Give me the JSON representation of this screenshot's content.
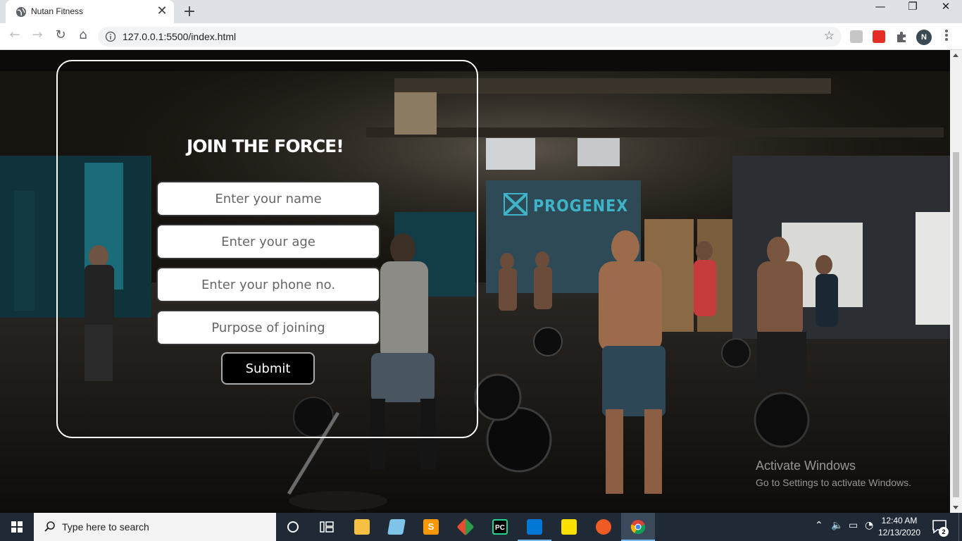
{
  "browser": {
    "tab_title": "Nutan Fitness",
    "tab_close": "✕",
    "new_tab": "+",
    "url": "127.0.0.1:5500/index.html",
    "profile_initial": "N",
    "window_controls": {
      "minimize": "—",
      "restore": "❐",
      "close": "✕"
    },
    "nav": {
      "back": "←",
      "forward": "→",
      "reload": "↻",
      "home": "⌂"
    },
    "bookmark_icon": "star-icon",
    "extensions": [
      "translate-extension-icon",
      "youtube-extension-icon",
      "puzzle-extensions-icon"
    ]
  },
  "page": {
    "form": {
      "title": "JOIN THE FORCE!",
      "name_placeholder": "Enter your name",
      "age_placeholder": "Enter your age",
      "phone_placeholder": "Enter your phone no.",
      "purpose_placeholder": "Purpose of joining",
      "submit_label": "Submit"
    },
    "background_sign": "PROGENEX",
    "activation": {
      "title": "Activate Windows",
      "subtitle": "Go to Settings to activate Windows."
    }
  },
  "taskbar": {
    "search_placeholder": "Type here to search",
    "apps": [
      {
        "name": "cortana-icon"
      },
      {
        "name": "task-view-icon"
      },
      {
        "name": "file-explorer-icon"
      },
      {
        "name": "notepad-app-icon"
      },
      {
        "name": "sublime-text-icon"
      },
      {
        "name": "git-icon"
      },
      {
        "name": "pycharm-icon",
        "label": "PC"
      },
      {
        "name": "vscode-icon"
      },
      {
        "name": "sticky-notes-icon"
      },
      {
        "name": "postman-icon"
      },
      {
        "name": "chrome-icon"
      }
    ],
    "time": "12:40 AM",
    "date": "12/13/2020",
    "notification_count": "2"
  },
  "colors": {
    "tab_strip": "#dee1e6",
    "taskbar": "#1f2a36",
    "card_border": "#ffffff",
    "submit_bg": "#000000"
  }
}
